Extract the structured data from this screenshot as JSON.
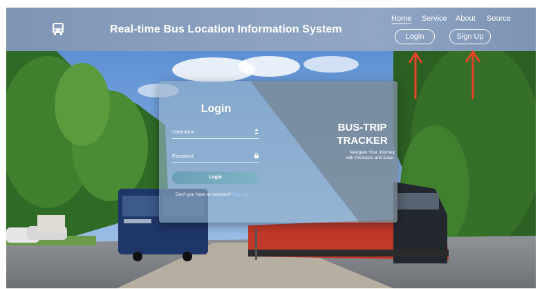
{
  "header": {
    "title": "Real-time Bus Location Information System",
    "logo_icon": "bus-icon",
    "nav": [
      {
        "label": "Home",
        "active": true
      },
      {
        "label": "Service",
        "active": false
      },
      {
        "label": "About",
        "active": false
      },
      {
        "label": "Source",
        "active": false
      }
    ],
    "login_button": "Login",
    "signup_button": "Sign Up"
  },
  "login_form": {
    "title": "Login",
    "username_placeholder": "Username",
    "username_icon": "user-icon",
    "password_placeholder": "Password",
    "password_icon": "lock-icon",
    "submit_label": "Login",
    "signup_prompt": "Don't you have an account?",
    "signup_link": "Sign Up"
  },
  "promo": {
    "title_line1": "BUS-TRIP",
    "title_line2": "TRACKER",
    "tagline_line1": "Navigate Your Journey",
    "tagline_line2": "with Precision and Ease."
  },
  "annotations": {
    "arrow_color": "#e8442a"
  },
  "colors": {
    "header_bg": "#8aa0bf",
    "button_accent": "#7fb4c6"
  }
}
